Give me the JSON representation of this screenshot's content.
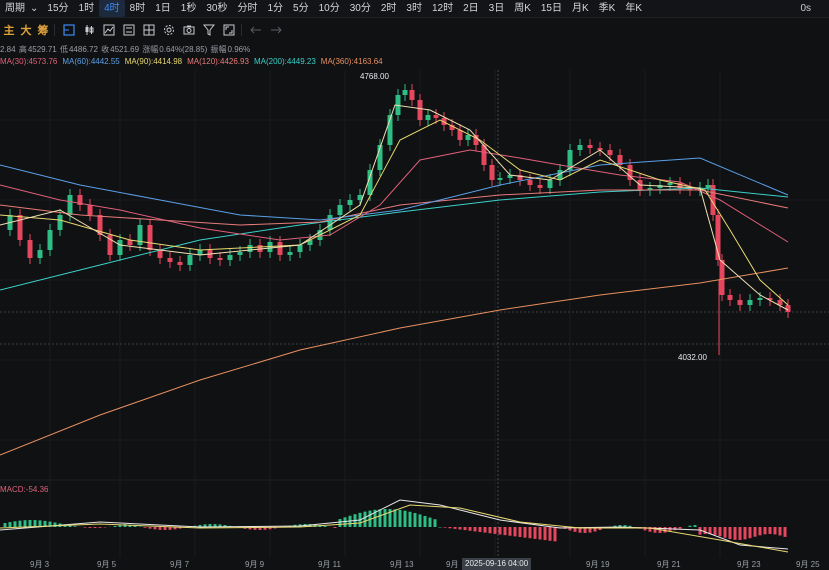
{
  "toolbar": {
    "items": [
      {
        "label": "周期",
        "active": false,
        "has_caret": true
      },
      {
        "label": "15分",
        "active": false
      },
      {
        "label": "1时",
        "active": false
      },
      {
        "label": "4时",
        "active": true
      },
      {
        "label": "8时",
        "active": false
      },
      {
        "label": "1日",
        "active": false
      },
      {
        "label": "1秒",
        "active": false
      },
      {
        "label": "30秒",
        "active": false
      },
      {
        "label": "分时",
        "active": false
      },
      {
        "label": "1分",
        "active": false
      },
      {
        "label": "5分",
        "active": false
      },
      {
        "label": "10分",
        "active": false
      },
      {
        "label": "30分",
        "active": false
      },
      {
        "label": "2时",
        "active": false
      },
      {
        "label": "3时",
        "active": false
      },
      {
        "label": "12时",
        "active": false
      },
      {
        "label": "2日",
        "active": false
      },
      {
        "label": "3日",
        "active": false
      },
      {
        "label": "周K",
        "active": false
      },
      {
        "label": "15日",
        "active": false
      },
      {
        "label": "月K",
        "active": false
      },
      {
        "label": "季K",
        "active": false
      },
      {
        "label": "年K",
        "active": false
      }
    ],
    "zoom_label": "0s"
  },
  "indicators": [
    "主",
    "大",
    "筹"
  ],
  "ohlc": {
    "open": "2.84",
    "high_label": "高",
    "high": "4529.71",
    "low_label": "低",
    "low": "4486.72",
    "close_label": "收",
    "close": "4521.69",
    "change_label": "涨幅",
    "change": "0.64%(28.85)",
    "amplitude_label": "振幅",
    "amplitude": "0.96%"
  },
  "ma": [
    {
      "label": "MA(30):4573.76",
      "color": "#e0607a"
    },
    {
      "label": "MA(60):4442.55",
      "color": "#5aa0e8"
    },
    {
      "label": "MA(90):4414.98",
      "color": "#e8d870"
    },
    {
      "label": "MA(120):4426.93",
      "color": "#e87a7a"
    },
    {
      "label": "MA(200):4449.23",
      "color": "#3ad0c8"
    },
    {
      "label": "MA(360):4163.64",
      "color": "#e89060"
    }
  ],
  "price_labels": {
    "high": "4768.00",
    "low": "4032.00"
  },
  "macd_label": "MACD:-54.36",
  "xaxis": {
    "ticks": [
      "9月 3",
      "9月 5",
      "9月 7",
      "9月 9",
      "9月 11",
      "9月 13",
      "9月",
      "7",
      "9月 19",
      "9月 21",
      "9月 23",
      "9月 25"
    ],
    "crosshair": "2025-09-16 04:00"
  },
  "colors": {
    "up": "#2ebd85",
    "down": "#e5475e",
    "accent": "#3d8bf5",
    "background": "#101113"
  },
  "chart_data": {
    "type": "candlestick",
    "extremes": {
      "high": 4768.0,
      "low": 4032.0
    },
    "macd": -54.36,
    "moving_averages": {
      "MA30": 4573.76,
      "MA60": 4442.55,
      "MA90": 4414.98,
      "MA120": 4426.93,
      "MA200": 4449.23,
      "MA360": 4163.64
    }
  }
}
